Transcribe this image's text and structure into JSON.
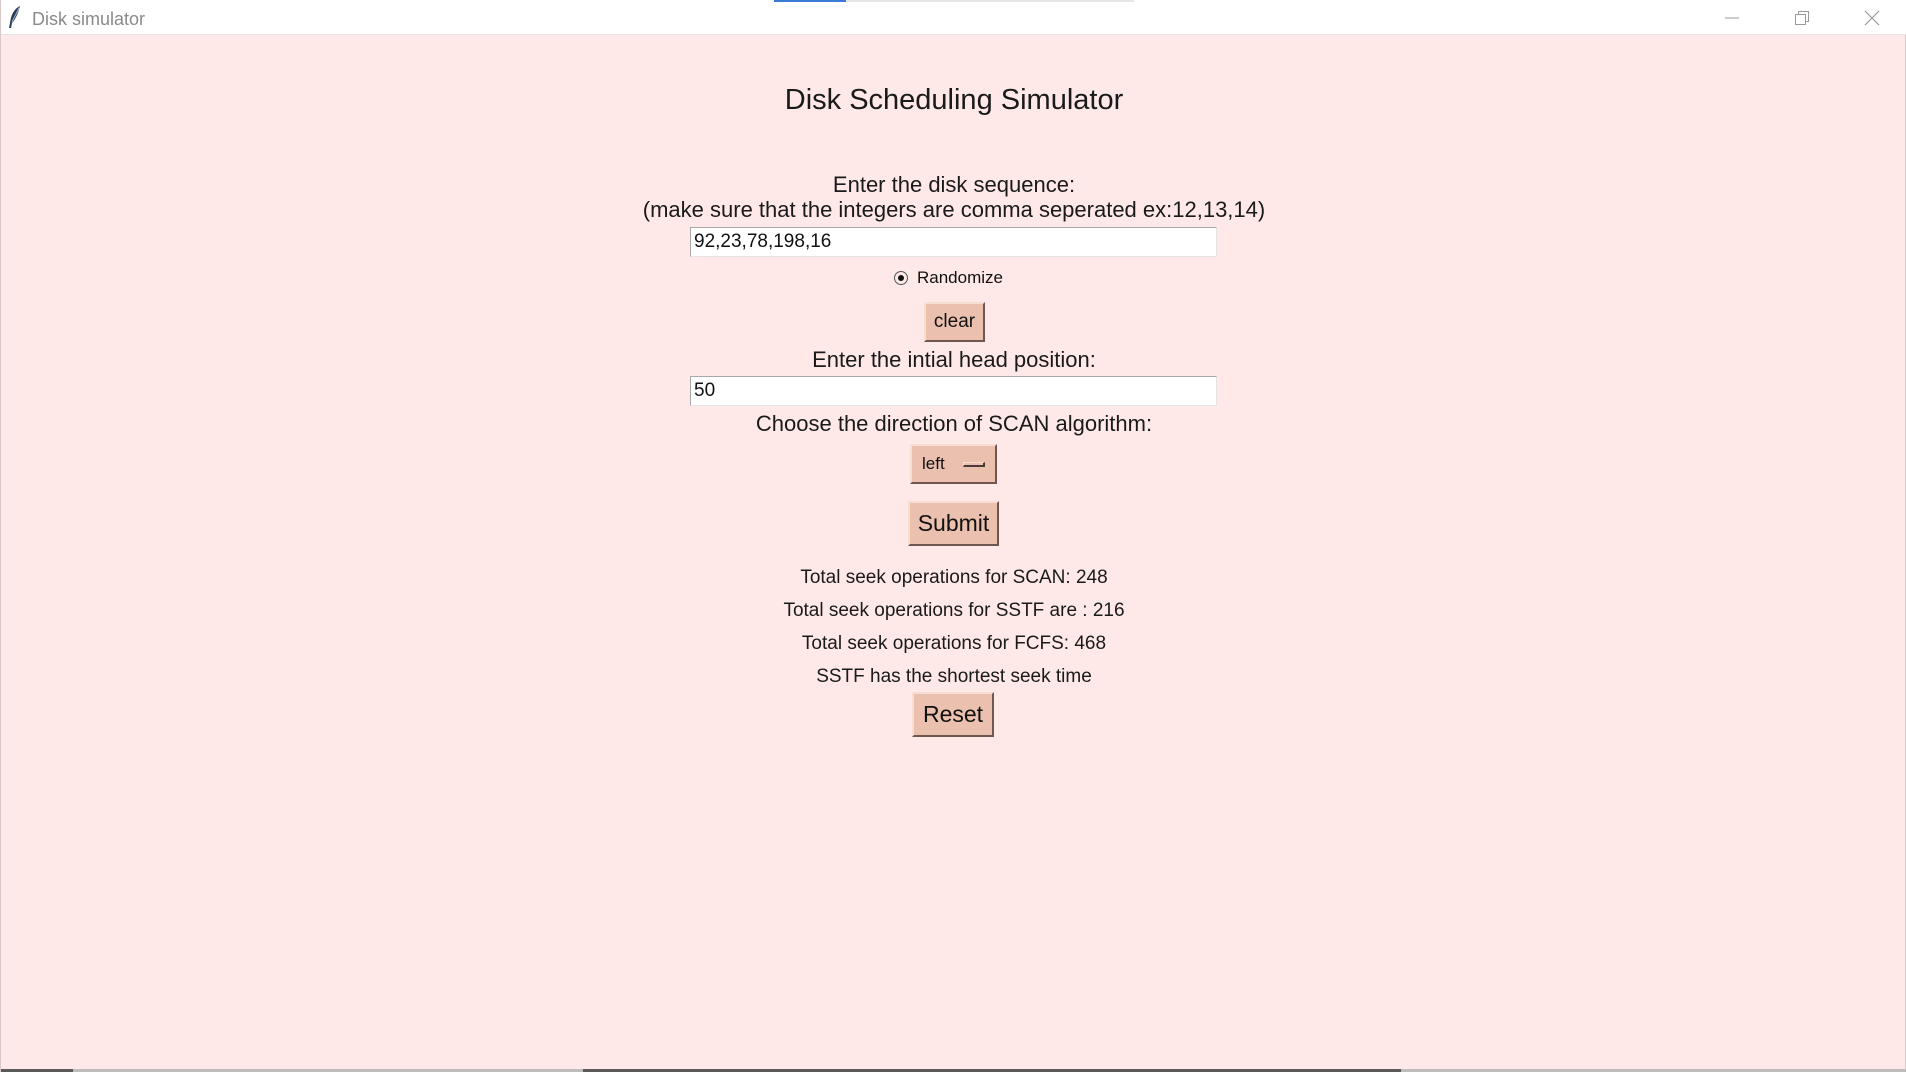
{
  "window": {
    "title": "Disk simulator"
  },
  "app": {
    "heading": "Disk Scheduling Simulator",
    "sequence_label": "Enter the disk sequence:",
    "sequence_hint": "(make sure that the integers are comma seperated ex:12,13,14)",
    "sequence_value": "92,23,78,198,16",
    "randomize_label": "Randomize",
    "randomize_selected": true,
    "clear_label": "clear",
    "head_label": "Enter the intial head position:",
    "head_value": "50",
    "direction_label": "Choose the direction of SCAN algorithm:",
    "direction_value": "left",
    "submit_label": "Submit",
    "reset_label": "Reset"
  },
  "results": {
    "scan": "Total seek operations for SCAN:  248",
    "sstf": "Total seek operations for SSTF are :  216",
    "fcfs": "Total seek operations for FCFS:  468",
    "conclusion": "SSTF has the shortest seek time"
  },
  "colors": {
    "background": "#ffe9e8",
    "button": "#ebc0ae"
  }
}
